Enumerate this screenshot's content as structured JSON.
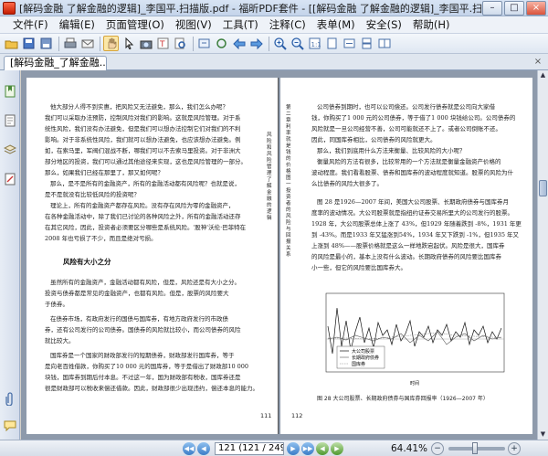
{
  "window": {
    "title": "[解码金融 了解金融的逻辑]_李国平.扫描版.pdf - 福昕PDF套件 - [[解码金融 了解金融的逻辑]_李国平.扫描版...",
    "minimize_label": "–",
    "maximize_label": "□",
    "close_label": "×"
  },
  "menu": {
    "items": [
      "文件(F)",
      "编辑(E)",
      "页面管理(O)",
      "视图(V)",
      "工具(T)",
      "注释(C)",
      "表单(M)",
      "安全(S)",
      "帮助(H)"
    ]
  },
  "toolbar": {
    "icons": [
      "open-folder-icon",
      "save-icon",
      "save-as-icon",
      "print-icon",
      "email-icon",
      "hand-tool-icon",
      "select-text-icon",
      "snapshot-icon",
      "typewriter-icon",
      "zoom-in-icon",
      "zoom-out-icon",
      "back-icon",
      "forward-icon"
    ]
  },
  "tab": {
    "label": "[解码金融_了解金融...",
    "close_label": "×"
  },
  "document": {
    "left_page": {
      "lines": [
        "他大部分人得不到实惠，把风险又无法避免，那么，我们怎么办呢？",
        "我们可以采取办法预防，控制风险对我们的影响。这就是风险管理。对于系",
        "统性风险，我们没有办法避免，但是我们可以想办法控制它们对我们的不利",
        "影响。对于非系统性风险，我们就可以想办法避免，也应该想办法避免。例",
        "如，在索马里，军阀们混战不断，哪我们可以不去索马里投资。对于非洲大",
        "部分地区的投资，我们可以通过其他途径来实现，这也是风险管理的一部分。",
        "那么，如果我们已经在那里了，那又如何呢？",
        "那么，是不是所有的金融资产，所有的金融活动都有风险呢？也就是说，",
        "是不是就没有比较低风险的投资呢？",
        "理论上，所有的金融资产都存在风险。没有存在风险为零的金融资产，",
        "在各种金融活动中，除了我们已讨论的各种风险之外，所有的金融活动还存",
        "在其它风险，因此，投资者必须要区分哪些是系统风险。'股神'沃伦·巴菲特在",
        "2008 年也亏损了不少，而且是绝对亏损。"
      ],
      "heading": "风险有大小之分",
      "lines2": [
        "虽然所有的金融资产，金融活动都有风险，但是，风险还是有大小之分。",
        "投资与债券都是常见的金融资产，也都有风险。但是，股票的风险要大",
        "于债券。",
        "在债券市场，有政府发行的国债与国库券，有地方政府发行的市政债",
        "券，还有公司发行的公司债券。国债券的风险就比较小，而公司债券的风险",
        "就比较大。",
        "国库券是一个国家的财政部发行的短期债券，财政部发行国库券，等于",
        "是向老百姓借款，你购买了10 000 元的国库券，等于是借出了财政部10 000",
        "块钱，国库券到期后付本息。不过这一年，国为财政部有税收，国库券还是",
        "很是财政部可以税收来偿还借款。因此，财政部很少出现违约，偿还本息的能力。"
      ],
      "side_text": "风险和风险管理 了解金融的逻辑",
      "page_number": "111"
    },
    "right_page": {
      "lines": [
        "公司债券到期时，也可以公司偿还。公司发行债券就是公司向大家借",
        "钱，你购买了1 000 元的公司债券，等于借了1 000 块钱给公司。公司债券的",
        "风险就是一旦公司经营不善，公司可能就还不上了。或者公司倒账不还。",
        "因此，同国库券相比，公司债券的风险就更大。",
        "那么，我们到底用什么方法来衡量、比较风险的大小呢？",
        "衡量风险的方法有很多，比较常用的一个方法就是衡量金融资产价格的",
        "波动程度。我们看看股票、债券和国库券的波动程度就知道。股票的风险为什",
        "么比债券的风险大很多了。",
        "图 28 是1926—2007 年间，美国大公司股票、长期政府债券与国库券月",
        "度率的波动情况。大公司股票就是指纽约证券交易所里大的公司发行的股票。",
        "1928 年，大公司股票总体上涨了 43%，但1929 年随着跌到 -8%，1931 年更",
        "到 -43%。而是1933 年又猛涨到54%，1934 年又下跌到 -1%，但1935 年又",
        "上涨到 48%——股票价格就是这么一样地跌宕起伏。风险是很大，国库券",
        "的风险是最小的，基本上没有什么波动。长期政府债券的风险要比国库券",
        "小一些，但它的风险要比国库券大。"
      ],
      "chart_legend": [
        "大公司股票",
        "长期政府债券",
        "国库券"
      ],
      "chart_xlabel": "时间",
      "chart_caption": "图 28   大公司股票、长期政府债券与国库券回报率（1926—2007 年）",
      "side_text": "第二章 利率就是钱的价格 图一 投资者的风险与回报 关系",
      "page_number": "112"
    }
  },
  "statusbar": {
    "page_value": "121 (121 / 249)",
    "zoom": "64.41%"
  },
  "colors": {
    "titlebar": "#c4d4ea",
    "docview_bg": "#8e9aab",
    "accent": "#3b7dc7"
  }
}
